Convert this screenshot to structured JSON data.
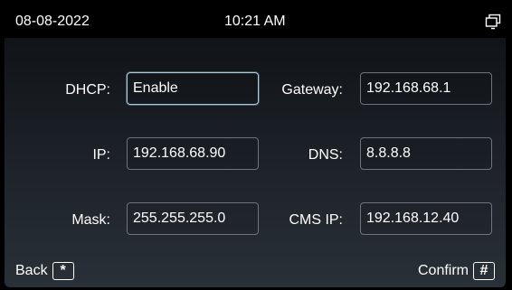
{
  "status_bar": {
    "date": "08-08-2022",
    "time": "10:21 AM",
    "window_icon": "window-restore-icon"
  },
  "form": {
    "dhcp": {
      "label": "DHCP:",
      "value": "Enable"
    },
    "gateway": {
      "label": "Gateway:",
      "value": "192.168.68.1"
    },
    "ip": {
      "label": "IP:",
      "value": "192.168.68.90"
    },
    "dns": {
      "label": "DNS:",
      "value": "8.8.8.8"
    },
    "mask": {
      "label": "Mask:",
      "value": "255.255.255.0"
    },
    "cms_ip": {
      "label": "CMS IP:",
      "value": "192.168.12.40"
    }
  },
  "softkeys": {
    "back_label": "Back",
    "back_icon": "star-key-icon",
    "back_key_glyph": "*",
    "confirm_label": "Confirm",
    "confirm_icon": "hash-key-icon",
    "confirm_key_glyph": "#"
  },
  "colors": {
    "focus_border": "#a8cfe0",
    "field_border": "#6f7478",
    "status_bar_bg": "#000000"
  }
}
